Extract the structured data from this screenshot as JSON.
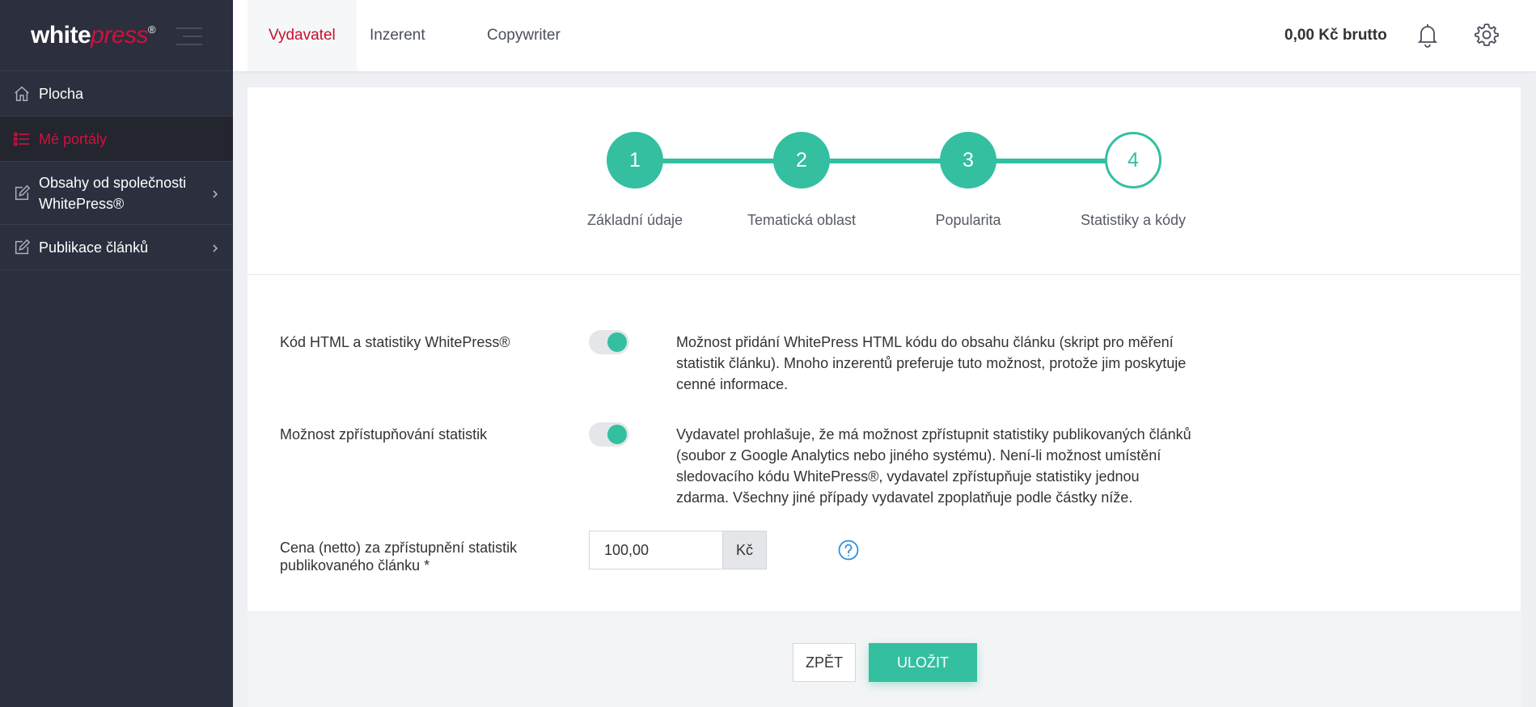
{
  "brand": {
    "logo_white": "white",
    "logo_press": "press",
    "logo_mark": "®"
  },
  "sidebar": {
    "items": [
      {
        "label": "Plocha",
        "icon": "home-icon"
      },
      {
        "label": "Mé portály",
        "icon": "list-icon",
        "active": true
      },
      {
        "label": "Obsahy od společnosti WhitePress®",
        "icon": "edit-icon",
        "has_children": true
      },
      {
        "label": "Publikace článků",
        "icon": "edit-icon",
        "has_children": true
      }
    ]
  },
  "header": {
    "tabs": [
      {
        "label": "Vydavatel",
        "active": true
      },
      {
        "label": "Inzerent"
      },
      {
        "label": "Copywriter"
      }
    ],
    "balance": "0,00 Kč brutto"
  },
  "stepper": {
    "steps": [
      {
        "number": "1",
        "label": "Základní údaje",
        "state": "done"
      },
      {
        "number": "2",
        "label": "Tematická oblast",
        "state": "done"
      },
      {
        "number": "3",
        "label": "Popularita",
        "state": "done"
      },
      {
        "number": "4",
        "label": "Statistiky a kódy",
        "state": "current"
      }
    ]
  },
  "form": {
    "html_code": {
      "label": "Kód HTML a statistiky WhitePress®",
      "enabled": true,
      "description": "Možnost přidání WhitePress HTML kódu do obsahu článku (skript pro měření statistik článku). Mnoho inzerentů preferuje tuto možnost, protože jim poskytuje cenné informace."
    },
    "stats_access": {
      "label": "Možnost zpřístupňování statistik",
      "enabled": true,
      "description": "Vydavatel prohlašuje, že má možnost zpřístupnit statistiky publikovaných článků (soubor z Google Analytics nebo jiného systému). Není-li možnost umístění sledovacího kódu WhitePress®, vydavatel zpřístupňuje statistiky jednou zdarma. Všechny jiné případy vydavatel zpoplatňuje podle částky níže."
    },
    "price": {
      "label": "Cena (netto) za zpřístupnění statistik publikovaného článku *",
      "value": "100,00",
      "unit": "Kč"
    }
  },
  "footer": {
    "back_label": "ZPĚT",
    "save_label": "ULOŽIT"
  },
  "colors": {
    "accent": "#34bfa1",
    "brand_red": "#d0113f",
    "sidebar_bg": "#2c2f3e"
  }
}
